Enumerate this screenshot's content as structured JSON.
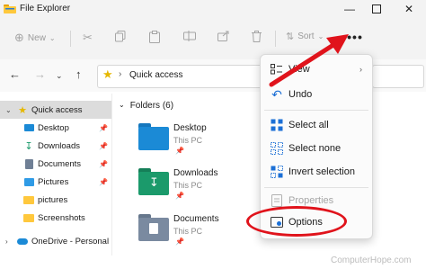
{
  "window": {
    "title": "File Explorer"
  },
  "toolbar": {
    "new_label": "New",
    "sort_label": "Sort",
    "more_label": "•••"
  },
  "address": {
    "path_label": "Quick access"
  },
  "sidebar": {
    "items": [
      {
        "label": "Quick access",
        "icon": "star-icon"
      },
      {
        "label": "Desktop",
        "icon": "desktop-icon"
      },
      {
        "label": "Downloads",
        "icon": "download-icon"
      },
      {
        "label": "Documents",
        "icon": "documents-icon"
      },
      {
        "label": "Pictures",
        "icon": "pictures-icon"
      },
      {
        "label": "pictures",
        "icon": "folder-icon"
      },
      {
        "label": "Screenshots",
        "icon": "folder-icon"
      },
      {
        "label": "OneDrive - Personal",
        "icon": "cloud-icon"
      }
    ]
  },
  "main": {
    "folders_header": "Folders (6)",
    "folders": [
      {
        "name": "Desktop",
        "sub": "This PC",
        "color": "#1b8ad6"
      },
      {
        "name": "Downloads",
        "sub": "This PC",
        "color": "#1b9a6b"
      },
      {
        "name": "Documents",
        "sub": "This PC",
        "color": "#7a8aa0"
      }
    ]
  },
  "menu": {
    "items": [
      {
        "label": "View",
        "icon": "view-icon",
        "disabled": false
      },
      {
        "label": "Undo",
        "icon": "undo-icon",
        "disabled": false
      },
      {
        "label": "Select all",
        "icon": "select-all-icon",
        "disabled": false
      },
      {
        "label": "Select none",
        "icon": "select-none-icon",
        "disabled": false
      },
      {
        "label": "Invert selection",
        "icon": "invert-selection-icon",
        "disabled": false
      },
      {
        "label": "Properties",
        "icon": "properties-icon",
        "disabled": true
      },
      {
        "label": "Options",
        "icon": "options-icon",
        "disabled": false
      }
    ]
  },
  "annotation": {
    "color": "#e0131b"
  },
  "watermark": "ComputerHope.com"
}
